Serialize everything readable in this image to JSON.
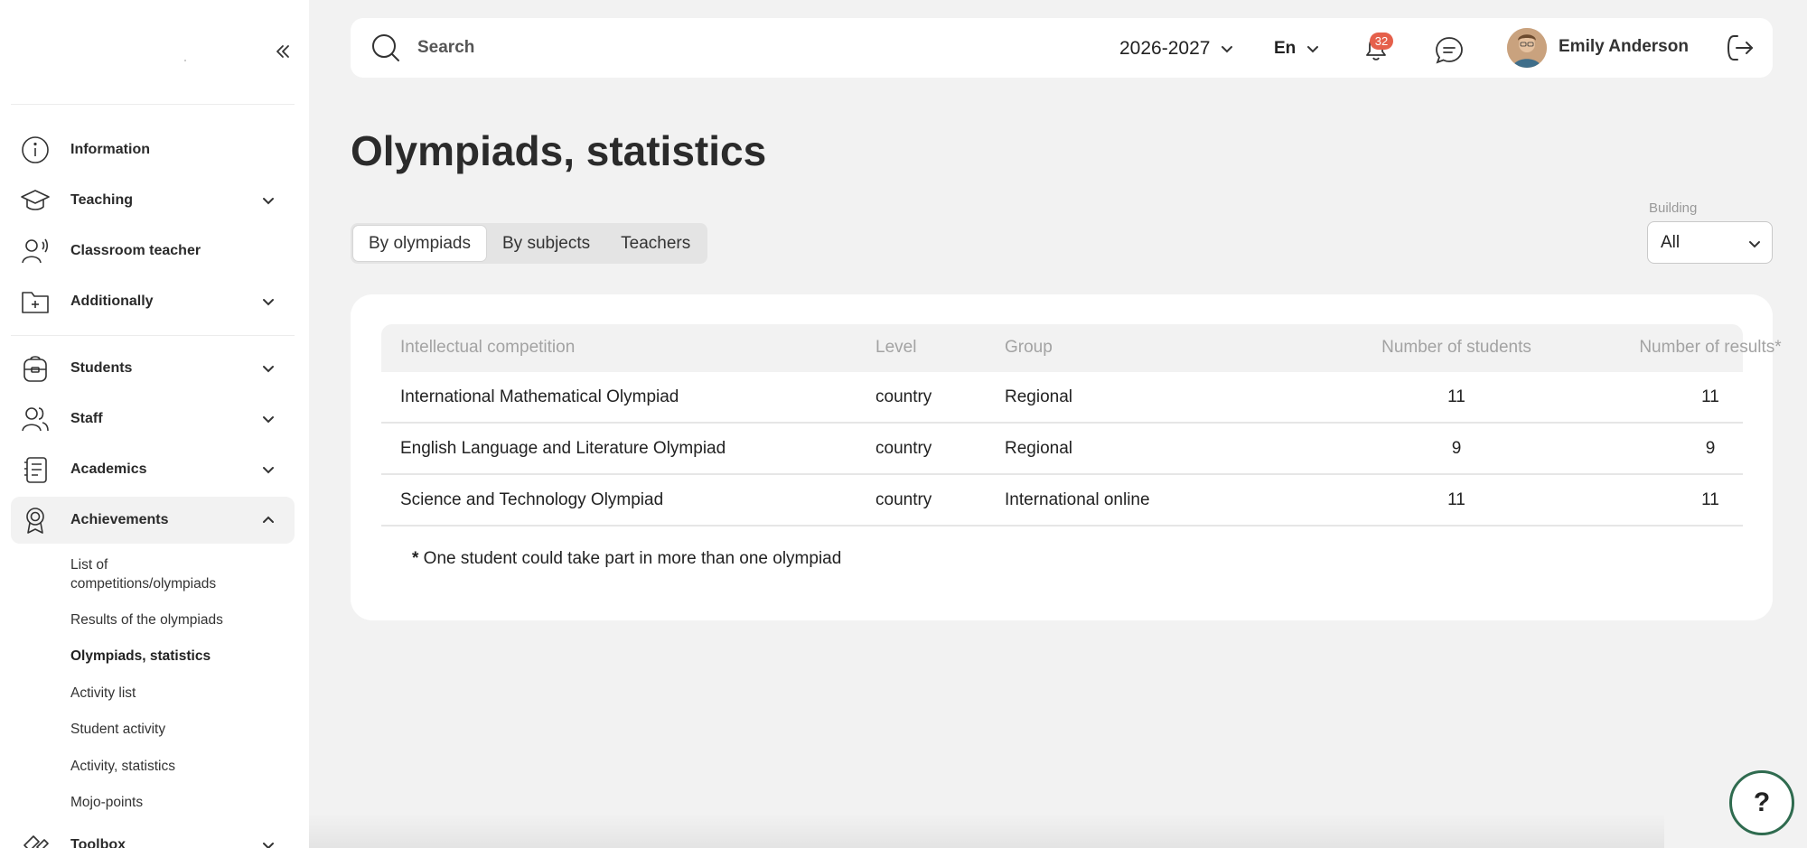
{
  "sidebar": {
    "items": [
      {
        "label": "Information",
        "icon": "info-icon"
      },
      {
        "label": "Teaching",
        "icon": "graduation-cap-icon"
      },
      {
        "label": "Classroom teacher",
        "icon": "teacher-icon"
      },
      {
        "label": "Additionally",
        "icon": "folder-plus-icon"
      },
      {
        "label": "Students",
        "icon": "backpack-icon"
      },
      {
        "label": "Staff",
        "icon": "staff-icon"
      },
      {
        "label": "Academics",
        "icon": "journal-icon"
      },
      {
        "label": "Achievements",
        "icon": "award-icon"
      },
      {
        "label": "Toolbox",
        "icon": "toolbox-icon"
      }
    ],
    "achievements_subitems": [
      "List of competitions/olympiads",
      "Results of the olympiads",
      "Olympiads, statistics",
      "Activity list",
      "Student activity",
      "Activity, statistics",
      "Mojo-points"
    ],
    "current_subitem": "Olympiads, statistics"
  },
  "topbar": {
    "search_placeholder": "Search",
    "year": "2026-2027",
    "language": "En",
    "notifications_count": "32",
    "user_name": "Emily Anderson"
  },
  "page": {
    "title": "Olympiads, statistics",
    "tabs": [
      "By olympiads",
      "By subjects",
      "Teachers"
    ],
    "active_tab": "By olympiads",
    "building_label": "Building",
    "building_value": "All"
  },
  "table": {
    "headers": [
      "Intellectual competition",
      "Level",
      "Group",
      "Number of students",
      "Number of results*"
    ],
    "rows": [
      [
        "International Mathematical Olympiad",
        "country",
        "Regional",
        "11",
        "11"
      ],
      [
        "English Language and Literature Olympiad",
        "country",
        "Regional",
        "9",
        "9"
      ],
      [
        "Science and Technology Olympiad",
        "country",
        "International online",
        "11",
        "11"
      ]
    ],
    "footnote_mark": "*",
    "footnote_text": " One student could take part in more than one olympiad"
  },
  "help_label": "?",
  "colors": {
    "badge": "#e5604b",
    "help_border": "#2f6b4f",
    "background": "#f2f2f2"
  }
}
